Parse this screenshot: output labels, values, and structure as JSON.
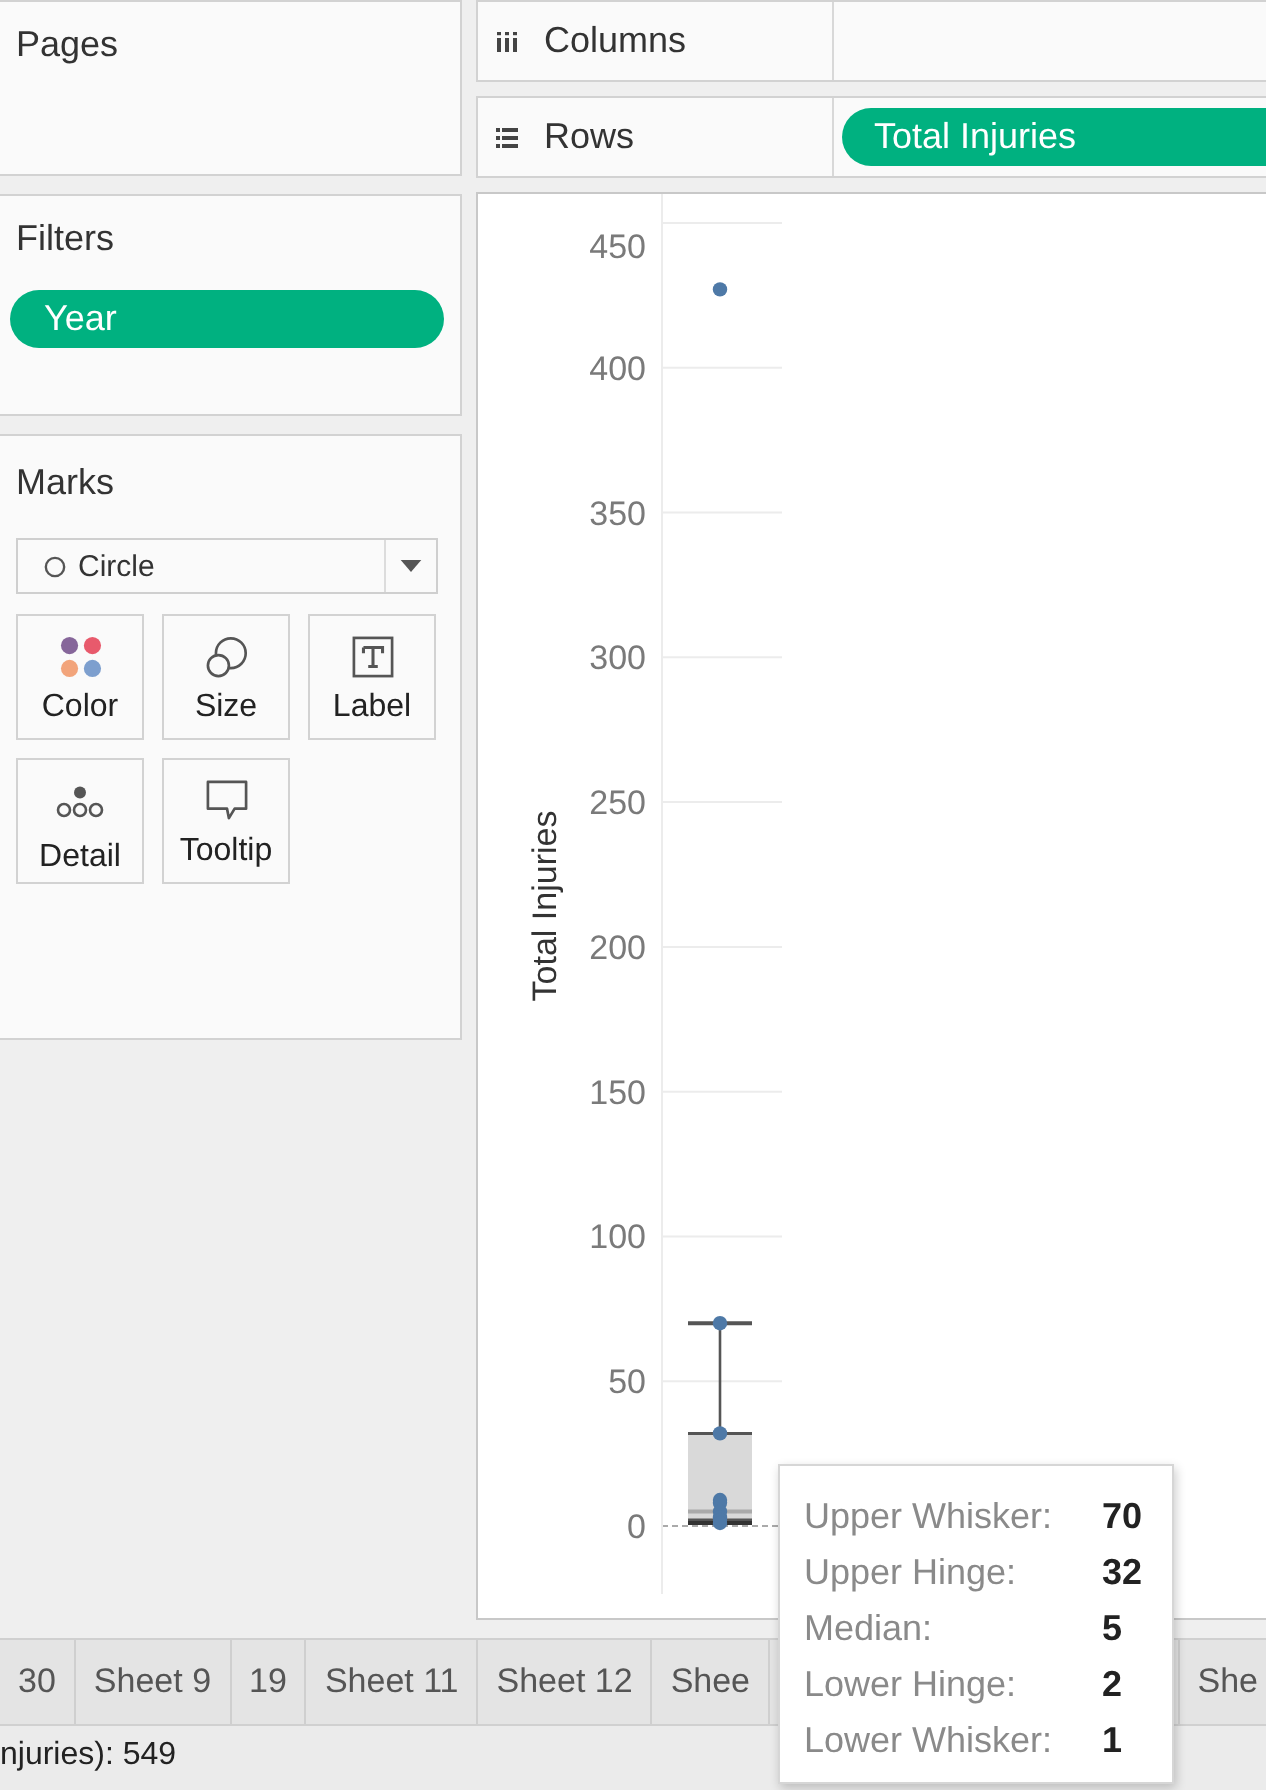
{
  "pages": {
    "title": "Pages"
  },
  "filters": {
    "title": "Filters",
    "pills": [
      "Year"
    ]
  },
  "marks": {
    "title": "Marks",
    "mark_type": "Circle",
    "buttons": [
      {
        "label": "Color",
        "kind": "color"
      },
      {
        "label": "Size",
        "kind": "size"
      },
      {
        "label": "Label",
        "kind": "label"
      },
      {
        "label": "Detail",
        "kind": "detail"
      },
      {
        "label": "Tooltip",
        "kind": "tooltip"
      }
    ]
  },
  "shelves": [
    {
      "label": "Columns",
      "kind": "columns"
    },
    {
      "label": "Rows",
      "kind": "rows",
      "pills": [
        "Total Injuries"
      ]
    }
  ],
  "chart": {
    "y_axis_title": "Total Injuries",
    "y_ticks": [
      "450",
      "400",
      "350",
      "300",
      "250",
      "200",
      "150",
      "100",
      "50",
      "0"
    ]
  },
  "tooltip": {
    "rows": [
      {
        "label": "Upper Whisker:",
        "value": "70"
      },
      {
        "label": "Upper Hinge:",
        "value": "32"
      },
      {
        "label": "Median:",
        "value": "5"
      },
      {
        "label": "Lower Hinge:",
        "value": "2"
      },
      {
        "label": "Lower Whisker:",
        "value": "1"
      }
    ]
  },
  "sheet_tabs": [
    {
      "label": "30",
      "selected": false
    },
    {
      "label": "Sheet 9",
      "selected": false
    },
    {
      "label": "19",
      "selected": false
    },
    {
      "label": "Sheet 11",
      "selected": false
    },
    {
      "label": "Sheet 12",
      "selected": false
    },
    {
      "label": "Shee",
      "selected": false
    },
    {
      "label": "She",
      "selected": false
    }
  ],
  "status_bar": {
    "text": "njuries): 549"
  }
}
